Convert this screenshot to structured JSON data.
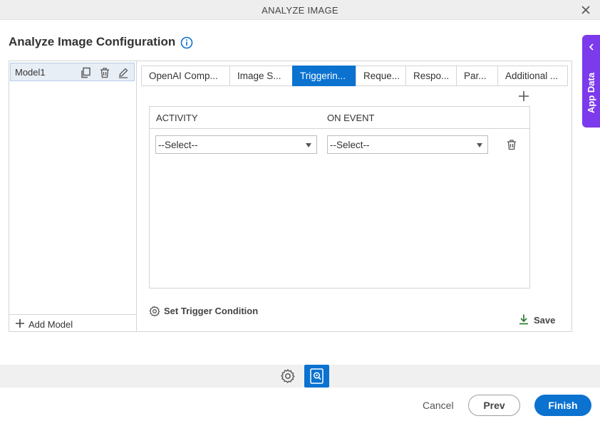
{
  "window": {
    "title": "ANALYZE IMAGE"
  },
  "page": {
    "heading": "Analyze Image Configuration"
  },
  "app_data": {
    "label": "App Data"
  },
  "models": {
    "items": [
      {
        "name": "Model1"
      }
    ],
    "add_label": "Add Model"
  },
  "tabs": [
    {
      "label": "OpenAI Comp..."
    },
    {
      "label": "Image S..."
    },
    {
      "label": "Triggerin..."
    },
    {
      "label": "Reque..."
    },
    {
      "label": "Respo..."
    },
    {
      "label": "Par..."
    },
    {
      "label": "Additional ..."
    }
  ],
  "active_tab": "Triggerin...",
  "grid": {
    "columns": [
      "ACTIVITY",
      "ON EVENT"
    ],
    "rows": [
      {
        "activity": "--Select--",
        "on_event": "--Select--"
      }
    ]
  },
  "actions": {
    "set_trigger_condition": "Set Trigger Condition",
    "save": "Save"
  },
  "footer": {
    "cancel": "Cancel",
    "prev": "Prev",
    "finish": "Finish"
  },
  "colors": {
    "accent": "#0b72d0",
    "app_data": "#7c3aed",
    "save_icon": "#2e7d32"
  }
}
